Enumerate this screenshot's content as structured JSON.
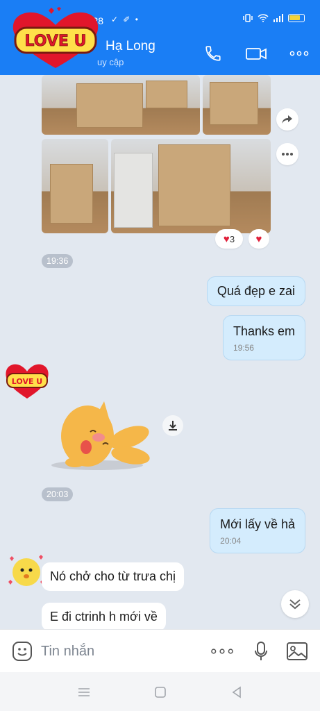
{
  "status_bar": {
    "time": "20:28",
    "notification_icons": "✓ ✐ •"
  },
  "header": {
    "contact_name": "Hạ Long",
    "status": "uy cập",
    "sticker_text": "LOVE U"
  },
  "messages": [
    {
      "from": "me",
      "text": "Quá đẹp e zai"
    },
    {
      "from": "me",
      "text": "Thanks em",
      "time": "19:56"
    },
    {
      "from": "me",
      "text": "Mới lấy về hả",
      "time": "20:04"
    },
    {
      "from": "them",
      "text": "Nó chở cho từ trưa chị"
    },
    {
      "from": "them",
      "text": "E đi ctrinh h mới về"
    }
  ],
  "timestamps": {
    "photos": "19:36",
    "sticker": "20:03"
  },
  "reactions": {
    "count": "3"
  },
  "avatar_sticker_text": "LOVE U",
  "input": {
    "placeholder": "Tin nhắn"
  },
  "colors": {
    "header": "#1a7ef5",
    "bubble_me": "#d4ecfd",
    "chat_bg": "#e2e8f0"
  },
  "icons": [
    "phone-icon",
    "video-call-icon",
    "more-icon",
    "share-icon",
    "download-icon",
    "sticker-icon",
    "mic-icon",
    "image-icon",
    "scroll-down-icon"
  ]
}
